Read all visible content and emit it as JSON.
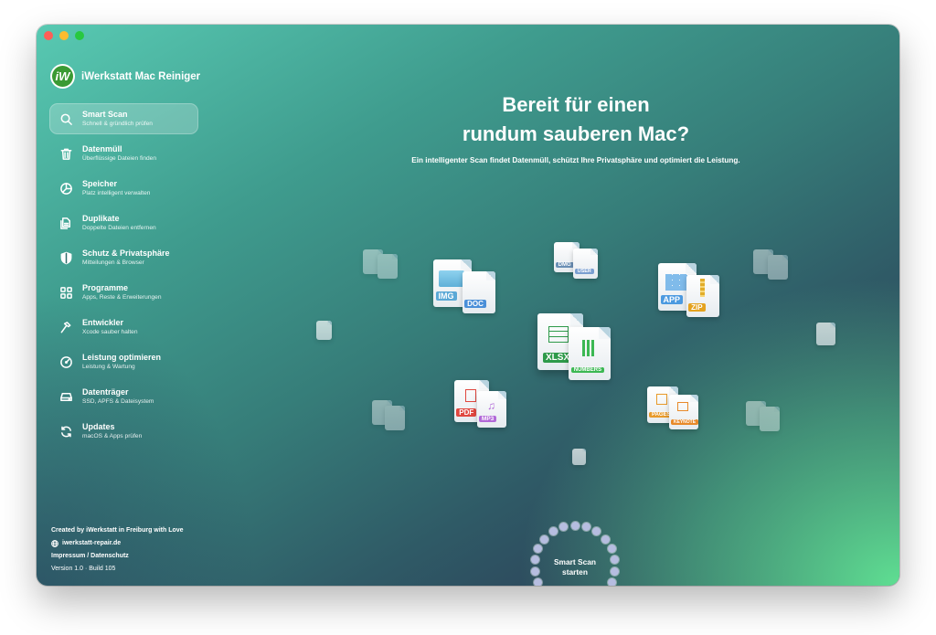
{
  "app": {
    "name": "iWerkstatt Mac Reiniger",
    "logo_letter": "iW"
  },
  "sidebar": {
    "items": [
      {
        "label": "Smart Scan",
        "sub": "Schnell & gründlich prüfen",
        "icon": "search-icon",
        "active": true
      },
      {
        "label": "Datenmüll",
        "sub": "Überflüssige Dateien finden",
        "icon": "trash-icon",
        "active": false
      },
      {
        "label": "Speicher",
        "sub": "Platz intelligent verwalten",
        "icon": "pie-chart-icon",
        "active": false
      },
      {
        "label": "Duplikate",
        "sub": "Doppelte Dateien entfernen",
        "icon": "duplicate-icon",
        "active": false
      },
      {
        "label": "Schutz & Privatsphäre",
        "sub": "Mitteilungen & Browser",
        "icon": "shield-icon",
        "active": false
      },
      {
        "label": "Programme",
        "sub": "Apps, Reste & Erweiterungen",
        "icon": "grid-icon",
        "active": false
      },
      {
        "label": "Entwickler",
        "sub": "Xcode sauber halten",
        "icon": "hammer-icon",
        "active": false
      },
      {
        "label": "Leistung optimieren",
        "sub": "Leistung & Wartung",
        "icon": "gauge-icon",
        "active": false
      },
      {
        "label": "Datenträger",
        "sub": "SSD, APFS & Dateisystem",
        "icon": "drive-icon",
        "active": false
      },
      {
        "label": "Updates",
        "sub": "macOS & Apps prüfen",
        "icon": "refresh-icon",
        "active": false
      }
    ]
  },
  "footer": {
    "credit": "Created by iWerkstatt in Freiburg with Love",
    "website": "iwerkstatt-repair.de",
    "legal": "Impressum / Datenschutz",
    "version": "Version 1.0 · Build 105"
  },
  "hero": {
    "title_line1": "Bereit für einen",
    "title_line2": "rundum sauberen Mac?",
    "subtitle": "Ein intelligenter Scan findet Datenmüll, schützt Ihre Privatsphäre und optimiert die Leistung."
  },
  "files": {
    "img": "IMG",
    "doc": "DOC",
    "dmg": "DMG",
    "user": "USER",
    "app": "APP",
    "zip": "ZIP",
    "xlsx": "XLSX",
    "numbers": "NUMBERS",
    "pdf": "PDF",
    "mp3": "MP3",
    "pages": "PAGES",
    "keynote": "KEYNOTE"
  },
  "start_button": {
    "line1": "Smart Scan",
    "line2": "starten"
  },
  "colors": {
    "accent_green": "#3a9a33",
    "gradient_top": "#58c9b2",
    "gradient_dark": "#2b2f4f",
    "gradient_glow": "#62e896"
  }
}
